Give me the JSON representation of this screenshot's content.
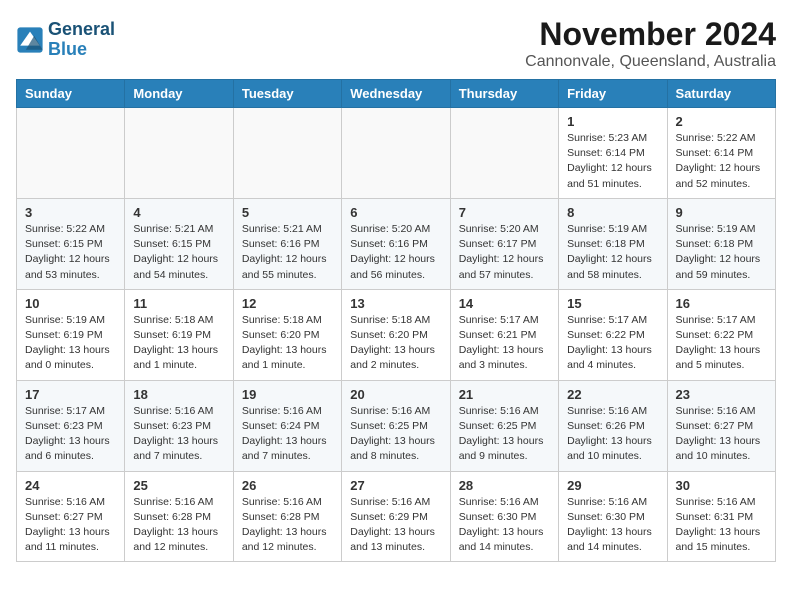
{
  "header": {
    "logo_line1": "General",
    "logo_line2": "Blue",
    "month": "November 2024",
    "location": "Cannonvale, Queensland, Australia"
  },
  "weekdays": [
    "Sunday",
    "Monday",
    "Tuesday",
    "Wednesday",
    "Thursday",
    "Friday",
    "Saturday"
  ],
  "weeks": [
    [
      {
        "day": "",
        "info": ""
      },
      {
        "day": "",
        "info": ""
      },
      {
        "day": "",
        "info": ""
      },
      {
        "day": "",
        "info": ""
      },
      {
        "day": "",
        "info": ""
      },
      {
        "day": "1",
        "info": "Sunrise: 5:23 AM\nSunset: 6:14 PM\nDaylight: 12 hours\nand 51 minutes."
      },
      {
        "day": "2",
        "info": "Sunrise: 5:22 AM\nSunset: 6:14 PM\nDaylight: 12 hours\nand 52 minutes."
      }
    ],
    [
      {
        "day": "3",
        "info": "Sunrise: 5:22 AM\nSunset: 6:15 PM\nDaylight: 12 hours\nand 53 minutes."
      },
      {
        "day": "4",
        "info": "Sunrise: 5:21 AM\nSunset: 6:15 PM\nDaylight: 12 hours\nand 54 minutes."
      },
      {
        "day": "5",
        "info": "Sunrise: 5:21 AM\nSunset: 6:16 PM\nDaylight: 12 hours\nand 55 minutes."
      },
      {
        "day": "6",
        "info": "Sunrise: 5:20 AM\nSunset: 6:16 PM\nDaylight: 12 hours\nand 56 minutes."
      },
      {
        "day": "7",
        "info": "Sunrise: 5:20 AM\nSunset: 6:17 PM\nDaylight: 12 hours\nand 57 minutes."
      },
      {
        "day": "8",
        "info": "Sunrise: 5:19 AM\nSunset: 6:18 PM\nDaylight: 12 hours\nand 58 minutes."
      },
      {
        "day": "9",
        "info": "Sunrise: 5:19 AM\nSunset: 6:18 PM\nDaylight: 12 hours\nand 59 minutes."
      }
    ],
    [
      {
        "day": "10",
        "info": "Sunrise: 5:19 AM\nSunset: 6:19 PM\nDaylight: 13 hours\nand 0 minutes."
      },
      {
        "day": "11",
        "info": "Sunrise: 5:18 AM\nSunset: 6:19 PM\nDaylight: 13 hours\nand 1 minute."
      },
      {
        "day": "12",
        "info": "Sunrise: 5:18 AM\nSunset: 6:20 PM\nDaylight: 13 hours\nand 1 minute."
      },
      {
        "day": "13",
        "info": "Sunrise: 5:18 AM\nSunset: 6:20 PM\nDaylight: 13 hours\nand 2 minutes."
      },
      {
        "day": "14",
        "info": "Sunrise: 5:17 AM\nSunset: 6:21 PM\nDaylight: 13 hours\nand 3 minutes."
      },
      {
        "day": "15",
        "info": "Sunrise: 5:17 AM\nSunset: 6:22 PM\nDaylight: 13 hours\nand 4 minutes."
      },
      {
        "day": "16",
        "info": "Sunrise: 5:17 AM\nSunset: 6:22 PM\nDaylight: 13 hours\nand 5 minutes."
      }
    ],
    [
      {
        "day": "17",
        "info": "Sunrise: 5:17 AM\nSunset: 6:23 PM\nDaylight: 13 hours\nand 6 minutes."
      },
      {
        "day": "18",
        "info": "Sunrise: 5:16 AM\nSunset: 6:23 PM\nDaylight: 13 hours\nand 7 minutes."
      },
      {
        "day": "19",
        "info": "Sunrise: 5:16 AM\nSunset: 6:24 PM\nDaylight: 13 hours\nand 7 minutes."
      },
      {
        "day": "20",
        "info": "Sunrise: 5:16 AM\nSunset: 6:25 PM\nDaylight: 13 hours\nand 8 minutes."
      },
      {
        "day": "21",
        "info": "Sunrise: 5:16 AM\nSunset: 6:25 PM\nDaylight: 13 hours\nand 9 minutes."
      },
      {
        "day": "22",
        "info": "Sunrise: 5:16 AM\nSunset: 6:26 PM\nDaylight: 13 hours\nand 10 minutes."
      },
      {
        "day": "23",
        "info": "Sunrise: 5:16 AM\nSunset: 6:27 PM\nDaylight: 13 hours\nand 10 minutes."
      }
    ],
    [
      {
        "day": "24",
        "info": "Sunrise: 5:16 AM\nSunset: 6:27 PM\nDaylight: 13 hours\nand 11 minutes."
      },
      {
        "day": "25",
        "info": "Sunrise: 5:16 AM\nSunset: 6:28 PM\nDaylight: 13 hours\nand 12 minutes."
      },
      {
        "day": "26",
        "info": "Sunrise: 5:16 AM\nSunset: 6:28 PM\nDaylight: 13 hours\nand 12 minutes."
      },
      {
        "day": "27",
        "info": "Sunrise: 5:16 AM\nSunset: 6:29 PM\nDaylight: 13 hours\nand 13 minutes."
      },
      {
        "day": "28",
        "info": "Sunrise: 5:16 AM\nSunset: 6:30 PM\nDaylight: 13 hours\nand 14 minutes."
      },
      {
        "day": "29",
        "info": "Sunrise: 5:16 AM\nSunset: 6:30 PM\nDaylight: 13 hours\nand 14 minutes."
      },
      {
        "day": "30",
        "info": "Sunrise: 5:16 AM\nSunset: 6:31 PM\nDaylight: 13 hours\nand 15 minutes."
      }
    ]
  ]
}
